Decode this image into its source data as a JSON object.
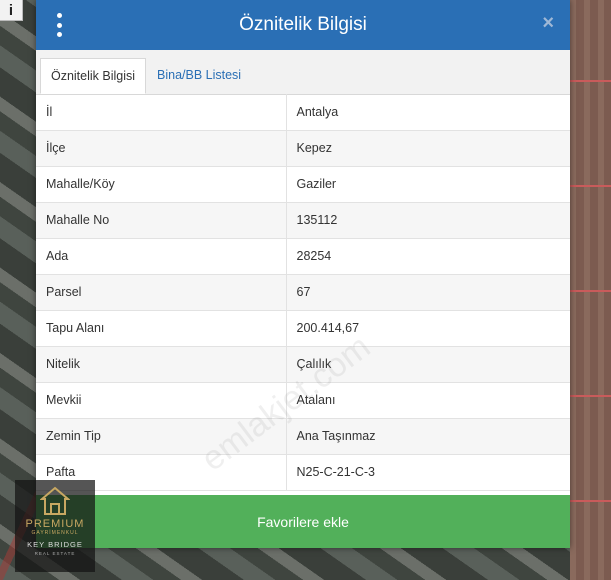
{
  "map": {
    "info_icon": "i"
  },
  "dialog": {
    "title": "Öznitelik Bilgisi",
    "menu_icon": "vertical-dots-icon",
    "close_icon": "×",
    "tabs": [
      {
        "label": "Öznitelik Bilgisi",
        "active": true
      },
      {
        "label": "Bina/BB Listesi",
        "active": false
      }
    ],
    "rows": [
      {
        "label": "İl",
        "value": "Antalya"
      },
      {
        "label": "İlçe",
        "value": "Kepez"
      },
      {
        "label": "Mahalle/Köy",
        "value": "Gaziler"
      },
      {
        "label": "Mahalle No",
        "value": "135112"
      },
      {
        "label": "Ada",
        "value": "28254"
      },
      {
        "label": "Parsel",
        "value": "67"
      },
      {
        "label": "Tapu Alanı",
        "value": "200.414,67"
      },
      {
        "label": "Nitelik",
        "value": "Çalılık"
      },
      {
        "label": "Mevkii",
        "value": "Atalanı"
      },
      {
        "label": "Zemin Tip",
        "value": "Ana Taşınmaz"
      },
      {
        "label": "Pafta",
        "value": "N25-C-21-C-3"
      }
    ],
    "favorite_button": "Favorilere ekle",
    "watermark": "emlakjet.com"
  },
  "logo": {
    "brand": "PREMIUM",
    "sub": "GAYRİMENKUL",
    "line2": "KEY BRIDGE",
    "line3": "REAL ESTATE"
  },
  "colors": {
    "header": "#2a6fb5",
    "button": "#52b05a",
    "tab_link": "#2a6fb5"
  }
}
